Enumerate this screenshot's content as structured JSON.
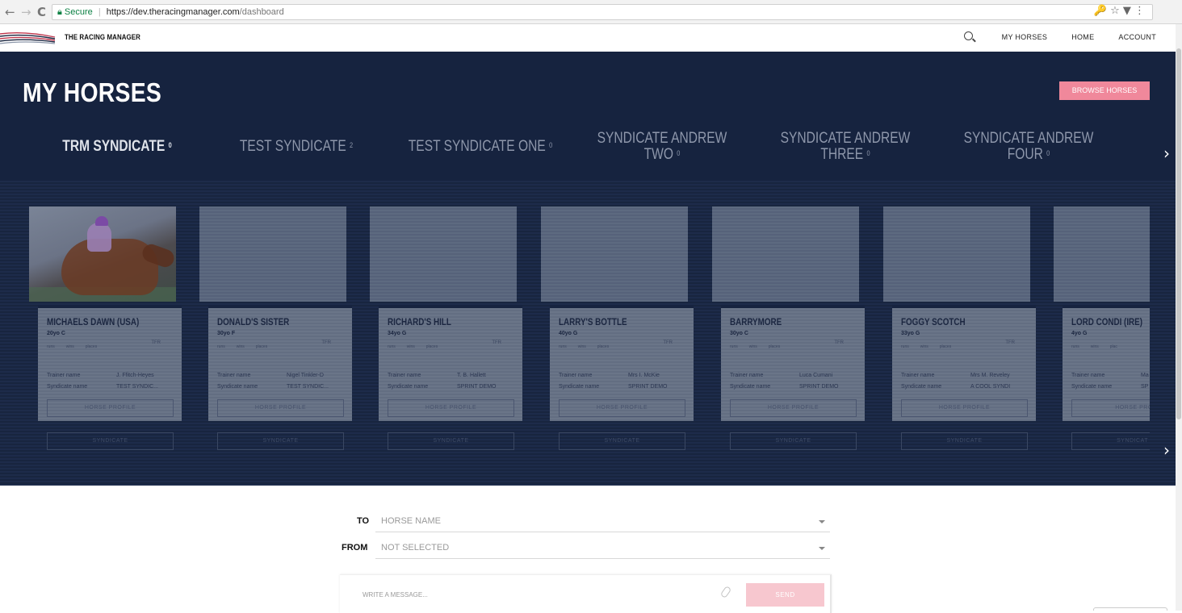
{
  "browser": {
    "back": "←",
    "forward": "→",
    "reload": "C",
    "secure_label": "Secure",
    "url_host": "https://dev.theracingmanager.com",
    "url_path": "/dashboard",
    "right_icons": "🔑 ☆ ▼ ⋮"
  },
  "site": {
    "logo_text": "THE RACING MANAGER",
    "nav": [
      "MY HORSES",
      "HOME",
      "ACCOUNT"
    ]
  },
  "hero": {
    "title": "MY HORSES",
    "browse_label": "BROWSE HORSES",
    "tabs": [
      {
        "label": "TRM SYNDICATE",
        "count": "0",
        "active": true
      },
      {
        "label": "TEST SYNDICATE",
        "count": "2"
      },
      {
        "label": "TEST SYNDICATE ONE",
        "count": "0"
      },
      {
        "line1": "SYNDICATE ANDREW",
        "line2": "TWO",
        "count": "0"
      },
      {
        "line1": "SYNDICATE ANDREW",
        "line2": "THREE",
        "count": "0"
      },
      {
        "line1": "SYNDICATE ANDREW",
        "line2": "FOUR",
        "count": "0"
      }
    ],
    "next_arrow": "›"
  },
  "cards": [
    {
      "name": "MICHAELS DAWN (USA)",
      "age": "20yo C",
      "trainer": "J. Ffitch-Heyes",
      "syndicate": "TEST SYNDIC..."
    },
    {
      "name": "DONALD'S SISTER",
      "age": "30yo F",
      "trainer": "Nigel Tinkler-D",
      "syndicate": "TEST SYNDIC..."
    },
    {
      "name": "RICHARD'S HILL",
      "age": "34yo G",
      "trainer": "T. B. Hallett",
      "syndicate": "SPRINT DEMO"
    },
    {
      "name": "LARRY'S BOTTLE",
      "age": "40yo G",
      "trainer": "Mrs I. McKie",
      "syndicate": "SPRINT DEMO"
    },
    {
      "name": "BARRYMORE",
      "age": "30yo C",
      "trainer": "Luca Cumani",
      "syndicate": "SPRINT DEMO"
    },
    {
      "name": "FOGGY SCOTCH",
      "age": "33yo G",
      "trainer": "Mrs M. Reveley",
      "syndicate": "A COOL SYNDI"
    },
    {
      "name": "LORD CONDI (IRE)",
      "age": "4yo G",
      "trainer": "Ma",
      "syndicate": "SP"
    }
  ],
  "card_labels": {
    "runs": "runs",
    "wins": "wins",
    "places": "places",
    "tfr": "TFR",
    "trainer_label": "Trainer name",
    "syndicate_label": "Syndicate name",
    "profile_btn": "HORSE PROFILE",
    "synd_btn": "SYNDICATE",
    "last_profile_btn": "HORSE PROFI",
    "last_synd_btn": "SYNDICAT",
    "last_places": "plac"
  },
  "message": {
    "to_label": "TO",
    "to_value": "HORSE NAME",
    "from_label": "FROM",
    "from_value": "NOT SELECTED",
    "placeholder": "WRITE A MESSAGE...",
    "send_label": "SEND"
  },
  "colors": {
    "hero_bg": "#16233f",
    "accent_pink": "#f0889b",
    "send_disabled": "#f7c7cf"
  }
}
